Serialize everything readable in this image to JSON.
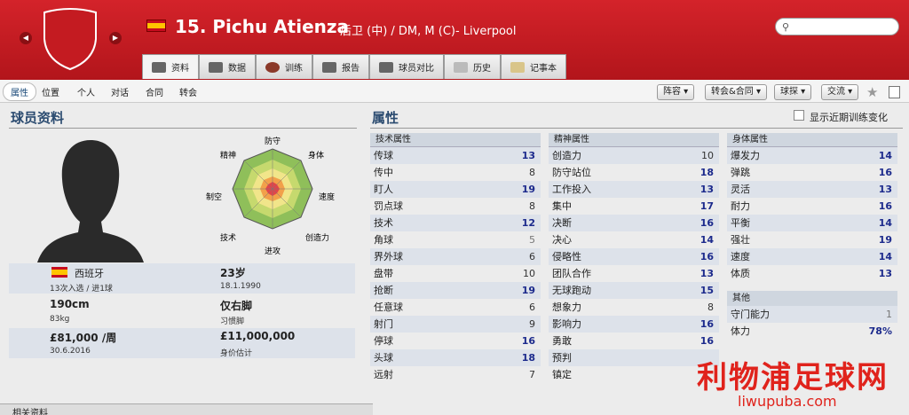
{
  "header": {
    "player_name": "15. Pichu Atienza",
    "player_meta": "后卫 (中) / DM, M (C)- Liverpool",
    "search_placeholder": ""
  },
  "tabs": [
    {
      "label": "资料",
      "active": true
    },
    {
      "label": "数据"
    },
    {
      "label": "训练"
    },
    {
      "label": "报告"
    },
    {
      "label": "球员对比"
    },
    {
      "label": "历史"
    },
    {
      "label": "记事本"
    }
  ],
  "subnav": {
    "items": [
      "属性",
      "位置",
      "个人",
      "对话",
      "合同",
      "转会"
    ],
    "dropdowns": [
      "阵容",
      "转会&合同",
      "球探",
      "交流"
    ]
  },
  "profile": {
    "title": "球员资料",
    "radar_labels": [
      "防守",
      "身体",
      "速度",
      "创造力",
      "进攻",
      "技术",
      "制空",
      "精神"
    ],
    "nationality": "西班牙",
    "age": "23岁",
    "caps": "13次入选 / 进1球",
    "dob": "18.1.1990",
    "height": "190cm",
    "foot": "仅右脚",
    "weight": "83kg",
    "foot_label": "习惯脚",
    "wage": "£81,000 /周",
    "value": "£11,000,000",
    "contract_end": "30.6.2016",
    "value_label": "身价估计",
    "footer": "相关资料"
  },
  "attributes": {
    "title": "属性",
    "show_recent": "显示近期训练变化",
    "technical": {
      "header": "技术属性",
      "rows": [
        [
          "传球",
          "13"
        ],
        [
          "传中",
          "8"
        ],
        [
          "盯人",
          "19"
        ],
        [
          "罚点球",
          "8"
        ],
        [
          "技术",
          "12"
        ],
        [
          "角球",
          "5"
        ],
        [
          "界外球",
          "6"
        ],
        [
          "盘带",
          "10"
        ],
        [
          "抢断",
          "19"
        ],
        [
          "任意球",
          "6"
        ],
        [
          "射门",
          "9"
        ],
        [
          "停球",
          "16"
        ],
        [
          "头球",
          "18"
        ],
        [
          "远射",
          "7"
        ]
      ]
    },
    "mental": {
      "header": "精神属性",
      "rows": [
        [
          "创造力",
          "10"
        ],
        [
          "防守站位",
          "18"
        ],
        [
          "工作投入",
          "13"
        ],
        [
          "集中",
          "17"
        ],
        [
          "决断",
          "16"
        ],
        [
          "决心",
          "14"
        ],
        [
          "侵略性",
          "16"
        ],
        [
          "团队合作",
          "13"
        ],
        [
          "无球跑动",
          "15"
        ],
        [
          "想象力",
          "8"
        ],
        [
          "影响力",
          "16"
        ],
        [
          "勇敢",
          "16"
        ],
        [
          "预判",
          ""
        ],
        [
          "镇定",
          ""
        ]
      ]
    },
    "physical": {
      "header": "身体属性",
      "rows": [
        [
          "爆发力",
          "14"
        ],
        [
          "弹跳",
          "16"
        ],
        [
          "灵活",
          "13"
        ],
        [
          "耐力",
          "16"
        ],
        [
          "平衡",
          "14"
        ],
        [
          "强壮",
          "19"
        ],
        [
          "速度",
          "14"
        ],
        [
          "体质",
          "13"
        ]
      ]
    },
    "other": {
      "header": "其他",
      "rows": [
        [
          "守门能力",
          "1"
        ],
        [
          "体力",
          "78%"
        ]
      ]
    }
  },
  "watermark": {
    "cn": "利物浦足球网",
    "url": "liwupuba.com"
  },
  "colors": {
    "header_red": "#c41b21",
    "attr_high": "#1c2a8c",
    "accent_blue": "#2b4b70"
  }
}
